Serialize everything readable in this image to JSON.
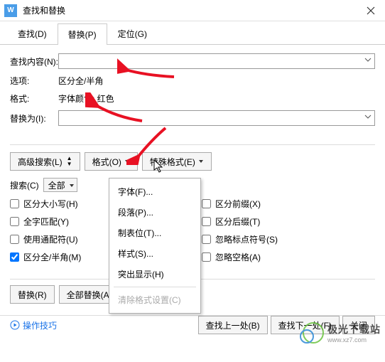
{
  "window": {
    "title": "查找和替换"
  },
  "tabs": {
    "find": "查找(D)",
    "replace": "替换(P)",
    "locate": "定位(G)"
  },
  "fields": {
    "find_label": "查找内容(N):",
    "options_label": "选项:",
    "options_value": "区分全/半角",
    "format_label": "格式:",
    "format_value": "字体颜色: 红色",
    "replace_label": "替换为(I):"
  },
  "buttons": {
    "advanced": "高级搜索(L)",
    "format_btn": "格式(O)",
    "special": "特殊格式(E)",
    "replace_one": "替换(R)",
    "replace_all": "全部替换(A)",
    "find_prev": "查找上一处(B)",
    "find_next": "查找下一处(F)",
    "close": "关闭"
  },
  "menu": {
    "font": "字体(F)...",
    "para": "段落(P)...",
    "tab": "制表位(T)...",
    "style": "样式(S)...",
    "highlight": "突出显示(H)",
    "clear": "清除格式设置(C)"
  },
  "search": {
    "label": "搜索(C)",
    "scope": "全部"
  },
  "checks": {
    "case": "区分大小写(H)",
    "whole": "全字匹配(Y)",
    "wildcard": "使用通配符(U)",
    "fullhalf": "区分全/半角(M)",
    "prefix": "区分前缀(X)",
    "suffix": "区分后缀(T)",
    "punct": "忽略标点符号(S)",
    "space": "忽略空格(A)"
  },
  "tips": "操作技巧",
  "watermark": {
    "name": "极光下载站",
    "url": "www.xz7.com"
  }
}
